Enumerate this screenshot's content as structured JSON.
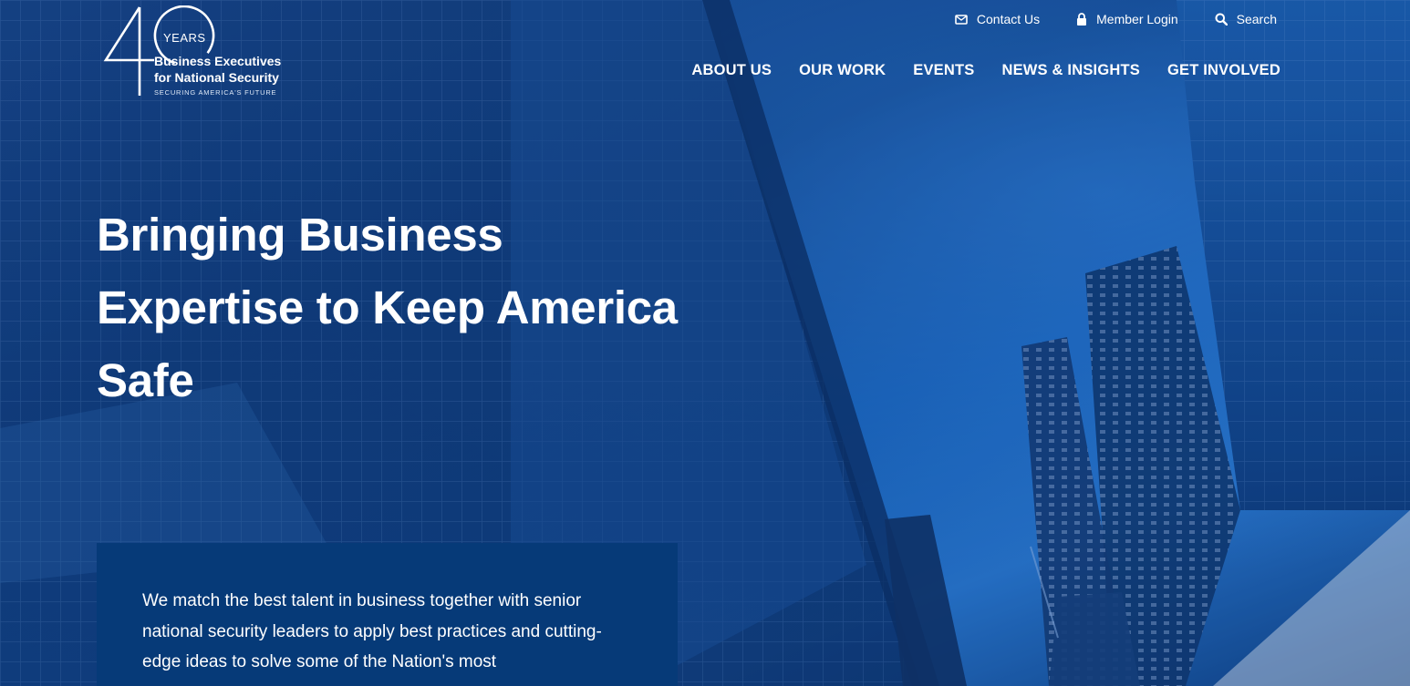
{
  "logo": {
    "years_label": "YEARS",
    "org_line1": "Business Executives",
    "org_line2": "for National Security",
    "tagline": "SECURING AMERICA'S FUTURE"
  },
  "utility_nav": {
    "contact": "Contact Us",
    "login": "Member Login",
    "search": "Search"
  },
  "main_nav": [
    "ABOUT US",
    "OUR WORK",
    "EVENTS",
    "NEWS & INSIGHTS",
    "GET INVOLVED"
  ],
  "hero": {
    "headline_line1": "Bringing Business",
    "headline_line2": "Expertise to Keep America",
    "headline_line3": "Safe"
  },
  "intro": {
    "text": "We match the best talent in business together with senior national security leaders to apply best practices and cutting-edge ideas to solve some of the Nation's most"
  },
  "colors": {
    "brand_blue": "#063a78",
    "text": "#ffffff"
  }
}
